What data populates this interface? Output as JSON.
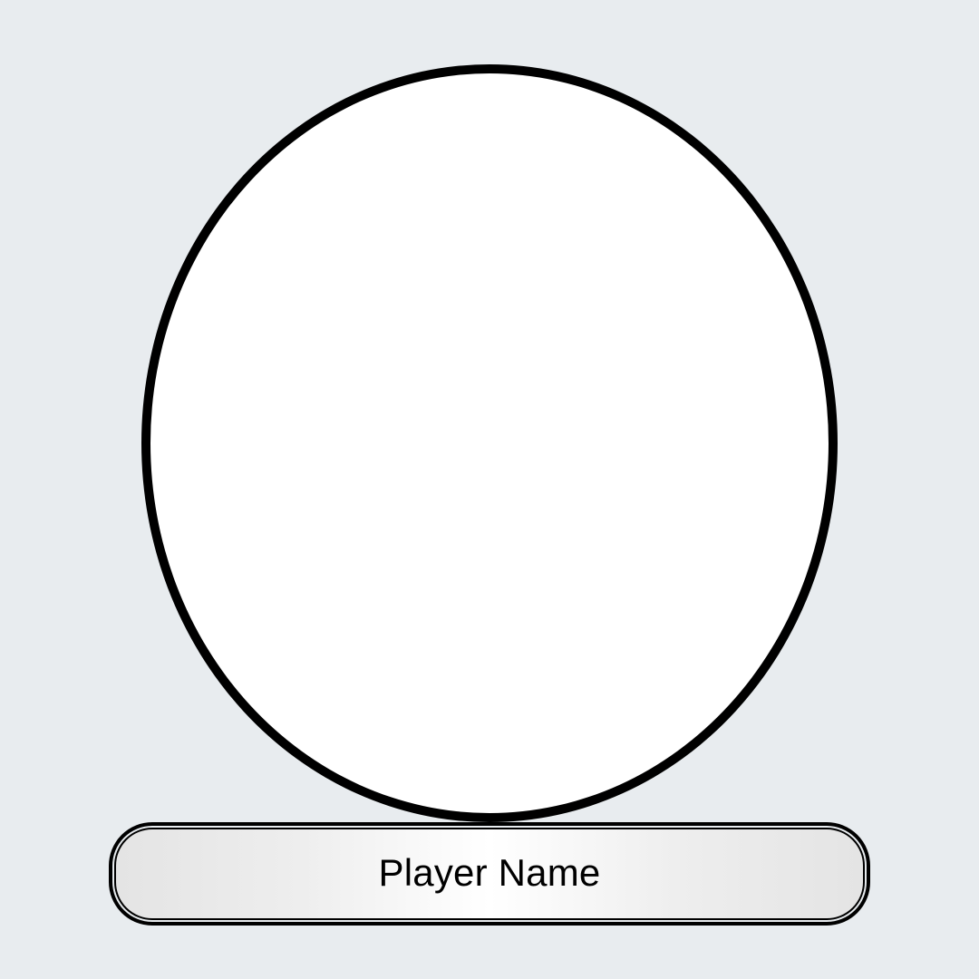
{
  "profile": {
    "player_name": "Player Name",
    "avatar_image": ""
  },
  "colors": {
    "background": "#e8ecef",
    "frame_border": "#000000",
    "avatar_fill": "#ffffff",
    "plate_gradient_edge": "#e4e4e4",
    "plate_gradient_center": "#ffffff",
    "text": "#000000"
  }
}
